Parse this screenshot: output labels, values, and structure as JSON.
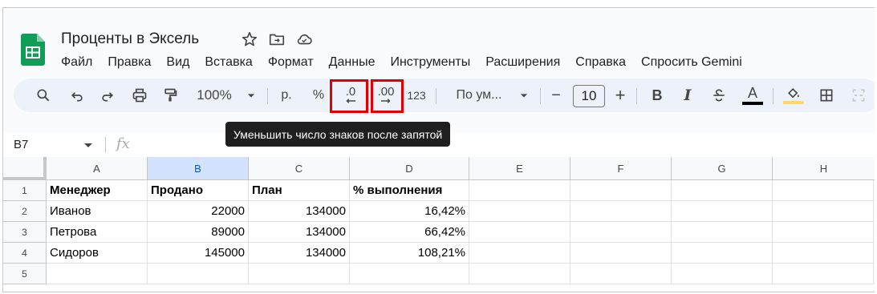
{
  "document": {
    "title": "Проценты в Эксель"
  },
  "menu": [
    "Файл",
    "Правка",
    "Вид",
    "Вставка",
    "Формат",
    "Данные",
    "Инструменты",
    "Расширения",
    "Справка",
    "Спросить Gemini"
  ],
  "toolbar": {
    "zoom": "100%",
    "currency": "р.",
    "percent": "%",
    "decrease_decimal": ".0",
    "increase_decimal": ".00",
    "more_formats": "123",
    "font": "По ум...",
    "font_size": "10",
    "minus": "−",
    "plus": "+",
    "bold": "B",
    "italic": "I",
    "strike": "S",
    "text_color": "A",
    "text_color_hex": "#000000",
    "highlight_color_hex": "#ffd966",
    "tooltip": "Уменьшить число знаков после запятой"
  },
  "formula_bar": {
    "cell_ref": "B7",
    "fx": "fx"
  },
  "columns": [
    "A",
    "B",
    "C",
    "D",
    "E",
    "F",
    "G",
    "H"
  ],
  "rows": [
    "1",
    "2",
    "3",
    "4",
    "5"
  ],
  "table": [
    [
      "Менеджер",
      "Продано",
      "План",
      "% выполнения"
    ],
    [
      "Иванов",
      "22000",
      "134000",
      "16,42%"
    ],
    [
      "Петрова",
      "89000",
      "134000",
      "66,42%"
    ],
    [
      "Сидоров",
      "145000",
      "134000",
      "108,21%"
    ],
    [
      "",
      "",
      "",
      ""
    ]
  ],
  "colors": {
    "accent": "#0b57d0",
    "selected_header": "#d3e3fd",
    "highlight_box": "#e00000"
  }
}
